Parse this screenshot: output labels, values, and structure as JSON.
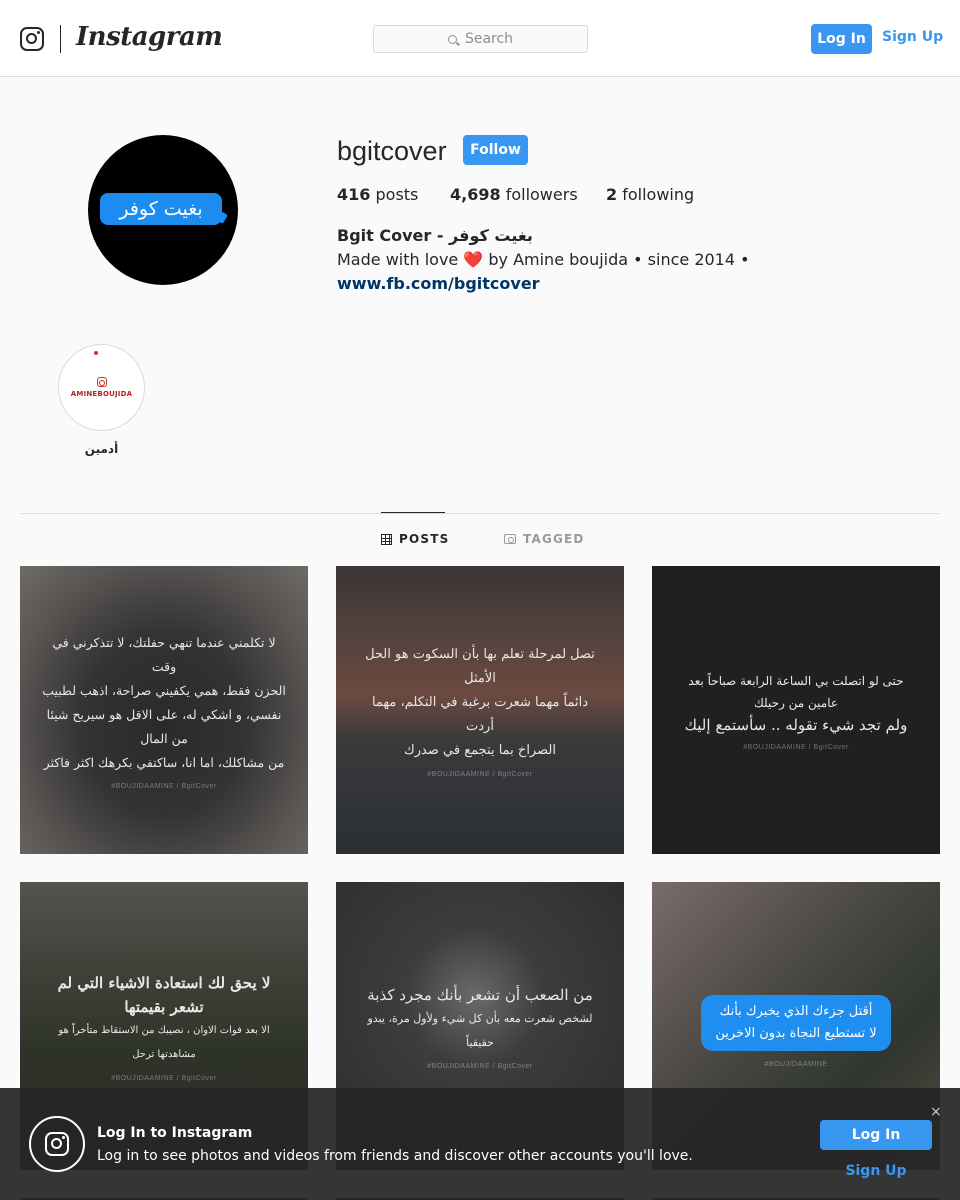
{
  "nav": {
    "brand": "Instagram",
    "search_placeholder": "Search",
    "login_label": "Log In",
    "signup_label": "Sign Up"
  },
  "profile": {
    "avatar_text": "بغيت كوفر",
    "username": "bgitcover",
    "follow_label": "Follow",
    "posts_count": "416",
    "posts_label": "posts",
    "followers_count": "4,698",
    "followers_label": "followers",
    "following_count": "2",
    "following_label": "following",
    "bio_name": "Bgit Cover - بغيت كوفر",
    "bio_text_before": "Made with love ",
    "bio_heart": "❤️",
    "bio_text_after": " by Amine boujida • since 2014 •",
    "bio_link": "www.fb.com/bgitcover"
  },
  "highlights": [
    {
      "cover_text": "AMINEBOUJIDA",
      "label": "أدمين"
    }
  ],
  "tabs": [
    {
      "label": "POSTS",
      "active": true
    },
    {
      "label": "TAGGED",
      "active": false
    }
  ],
  "posts": [
    {
      "lines": [
        "لا تكلمني عندما تنهي حفلتك، لا تتذكرني في وقت",
        "الحزن فقط، همي يكفيني صراحة، اذهب لطبيب",
        "نفسي، و اشكي له، على الاقل هو سيربح شيئا من المال",
        "من مشاكلك، اما انا، ساكتفي بكرهك اكثر فاكثر"
      ],
      "watermark": "#BOUJIDAAMINE / BgitCover"
    },
    {
      "lines": [
        "تصل لمرحلة تعلم بها بأن السكوت هو الحل الأمثل",
        "دائماً مهما شعرت برغبة في التكلم، مهما أردت",
        "الصراخ بما يتجمع في صدرك"
      ],
      "watermark": "#BOUJIDAAMINE / BgitCover"
    },
    {
      "lines": [
        "حتى لو اتصلت بي الساعة الرابعة صباحاً بعد عامين من رحيلك",
        "ولم تجد شيء تقوله .. سأستمع إليك"
      ],
      "watermark": "#BOUJIDAAMINE / BgitCover"
    },
    {
      "lines": [
        "لا يحق لك استعادة الاشياء التي لم تشعر بقيمتها",
        "الا بعد فوات الاوان ، نصيبك من الاستقاط متأخراً هو مشاهدتها ترحل"
      ],
      "watermark": "#BOUJIDAAMINE / BgitCover"
    },
    {
      "lines": [
        "من الصعب أن تشعر بأنك مجرد كذبة",
        "لشخص شعرت معه بأن كل شيء ولأول مرة، يبدو حقيقياً"
      ],
      "watermark": "#BOUJIDAAMINE / BgitCover"
    },
    {
      "lines": [
        "أقتل جزءك الذي يخبرك بأنك",
        "لا تستطيع النجاة بدون الاخرين"
      ],
      "watermark": "#BOUJIDAAMINE"
    }
  ],
  "banner": {
    "title": "Log In to Instagram",
    "subtitle": "Log in to see photos and videos from friends and discover other accounts you'll love.",
    "login_label": "Log In",
    "signup_label": "Sign Up",
    "close_glyph": "×"
  },
  "colors": {
    "accent": "#3897f0",
    "link": "#003569",
    "text": "#262626",
    "background": "#fafafa"
  },
  "icons": [
    "instagram-icon",
    "search-icon",
    "grid-icon",
    "tagged-icon",
    "close-icon"
  ]
}
